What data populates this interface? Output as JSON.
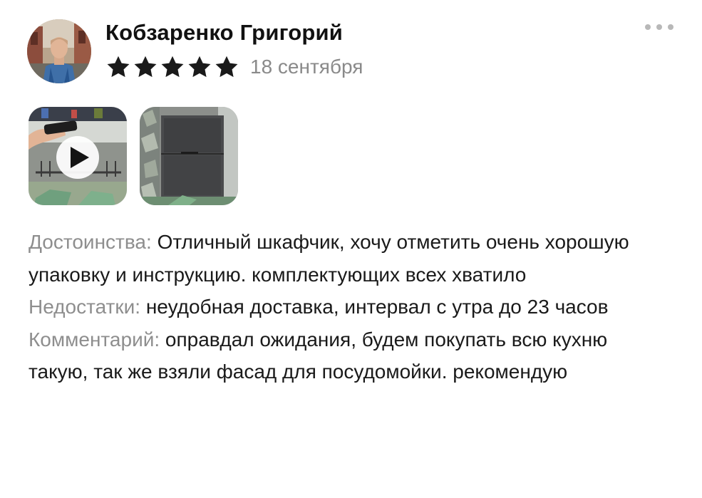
{
  "review": {
    "author": {
      "name": "Кобзаренко  Григорий"
    },
    "rating": {
      "value": 5,
      "max": 5,
      "star_color": "#1a1a1a"
    },
    "date": "18 сентября",
    "more_icon": "more-horizontal-icon",
    "media": [
      {
        "kind": "video",
        "icon": "play-icon"
      },
      {
        "kind": "photo"
      }
    ],
    "sections": {
      "pros": {
        "label": "Достоинства:",
        "text": "Отличный шкафчик, хочу отметить очень хорошую упаковку и инструкцию. комплектующих всех хватило"
      },
      "cons": {
        "label": "Недостатки:",
        "text": "неудобная доставка, интервал с утра до 23 часов"
      },
      "comment": {
        "label": "Комментарий:",
        "text": "оправдал ожидания, будем покупать всю кухню такую, так же взяли фасад для посудомойки. рекомендую"
      }
    }
  }
}
